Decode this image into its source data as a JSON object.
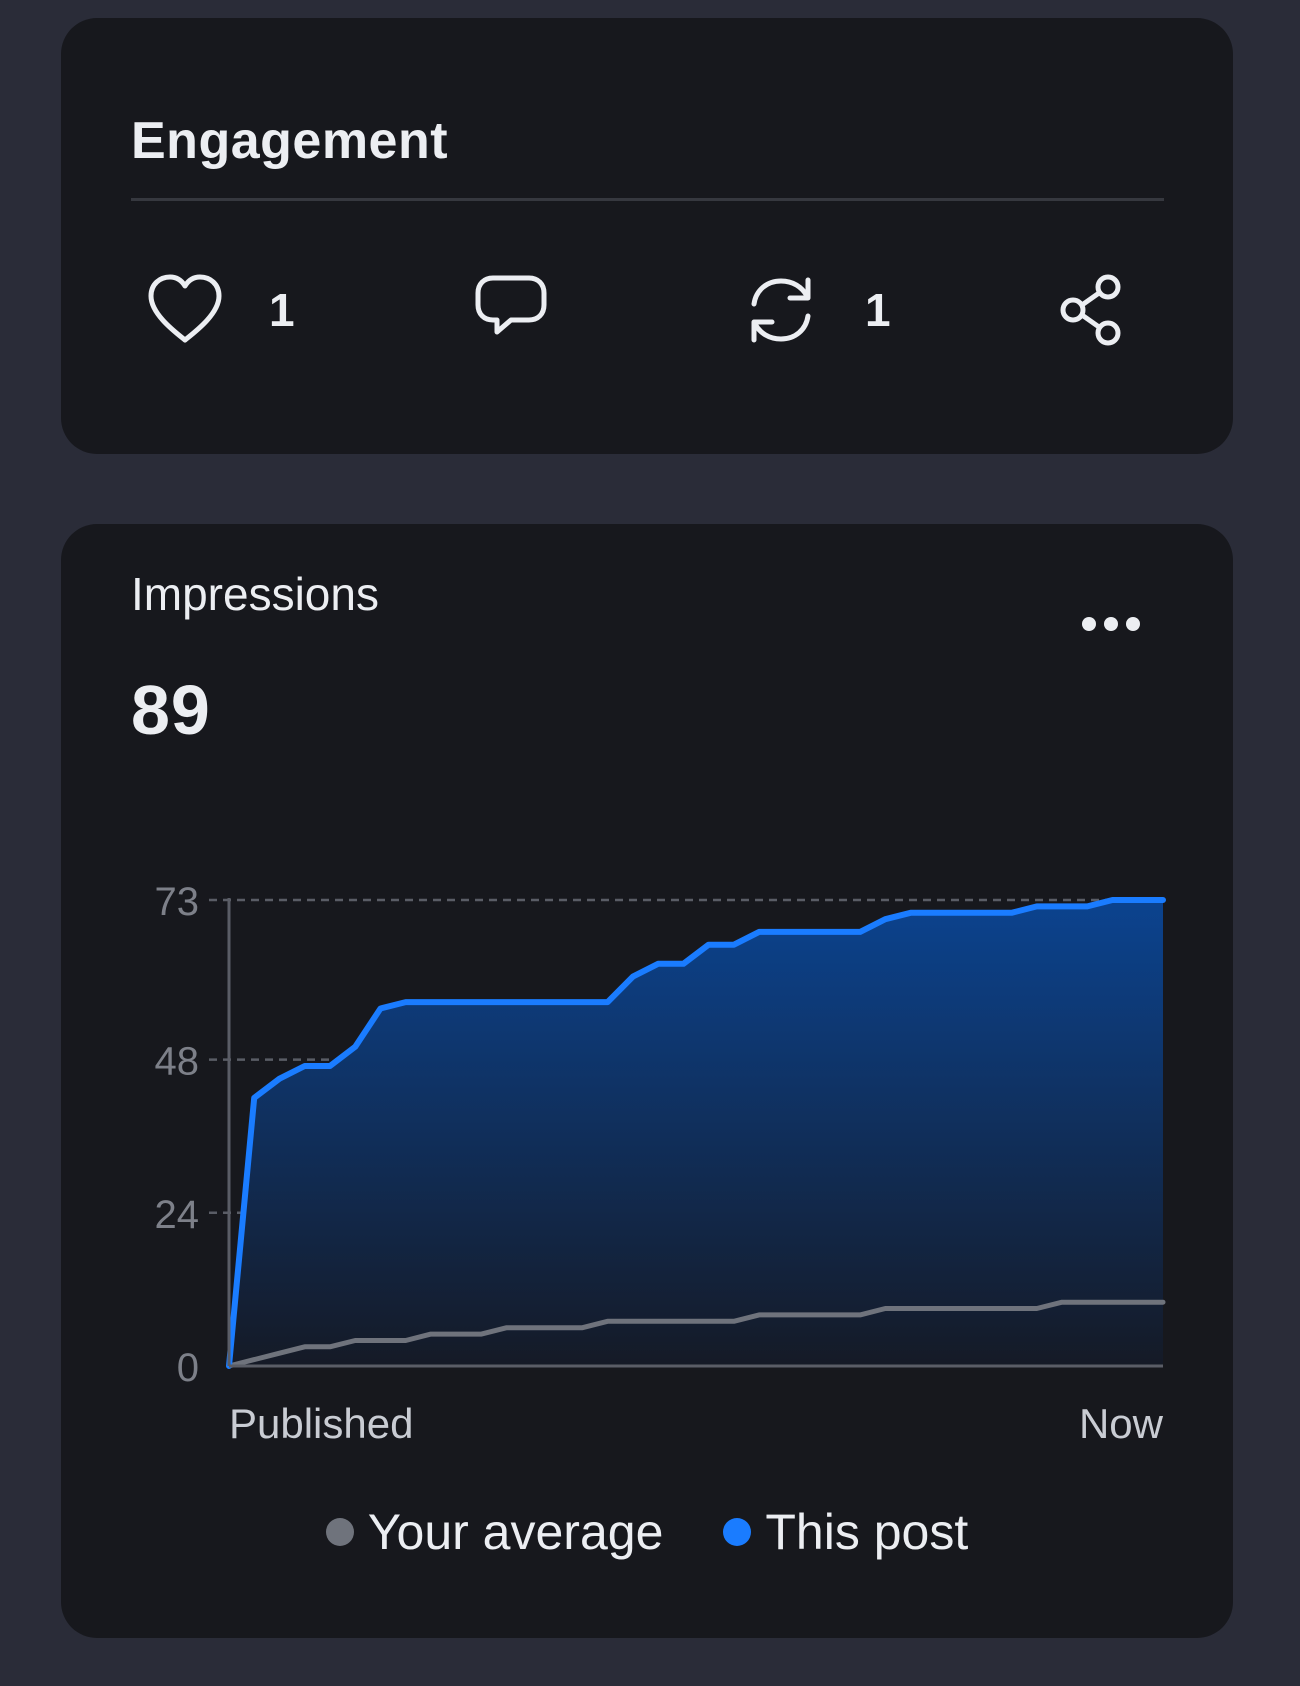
{
  "engagement": {
    "title": "Engagement",
    "like_count": "1",
    "comment_count": "",
    "repost_count": "1",
    "icons": [
      "heart-icon",
      "comment-icon",
      "repost-icon",
      "share-icon"
    ]
  },
  "impressions": {
    "label": "Impressions",
    "value": "89",
    "more_icon": "more-icon"
  },
  "colors": {
    "background": "#2a2c38",
    "card": "#17181d",
    "this_post": "#1a7cff",
    "your_average": "#6f737c"
  },
  "chart_data": {
    "type": "area",
    "x_labels": [
      "Published",
      "Now"
    ],
    "yticks": [
      0,
      24,
      48,
      73
    ],
    "ylim": [
      0,
      73
    ],
    "grid": true,
    "legend_position": "bottom",
    "series": [
      {
        "name": "Your average",
        "color": "#6f737c",
        "values": [
          0,
          1,
          2,
          3,
          3,
          4,
          4,
          4,
          5,
          5,
          5,
          6,
          6,
          6,
          6,
          7,
          7,
          7,
          7,
          7,
          7,
          8,
          8,
          8,
          8,
          8,
          9,
          9,
          9,
          9,
          9,
          9,
          9,
          10,
          10,
          10,
          10,
          10
        ]
      },
      {
        "name": "This post",
        "color": "#1a7cff",
        "values": [
          0,
          42,
          45,
          47,
          47,
          50,
          56,
          57,
          57,
          57,
          57,
          57,
          57,
          57,
          57,
          57,
          61,
          63,
          63,
          66,
          66,
          68,
          68,
          68,
          68,
          68,
          70,
          71,
          71,
          71,
          71,
          71,
          72,
          72,
          72,
          73,
          73,
          73
        ]
      }
    ],
    "legend": [
      "Your average",
      "This post"
    ]
  }
}
